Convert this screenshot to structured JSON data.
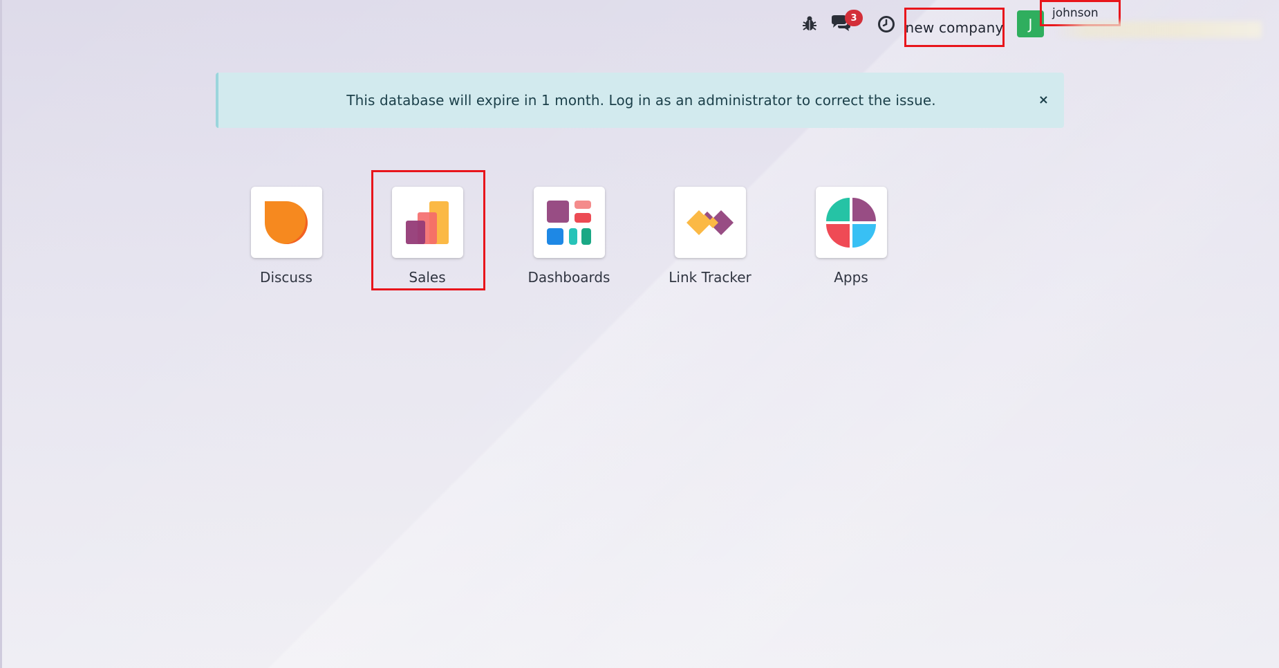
{
  "navbar": {
    "icons": {
      "debug": "bug-icon",
      "messages": "chat-icon",
      "activities": "clock-icon"
    },
    "messages_badge": "3",
    "company": "new company",
    "user": {
      "avatar_initial": "J",
      "name": "johnson"
    }
  },
  "alert": {
    "message": "This database will expire in 1 month. Log in as an administrator to correct the issue.",
    "close": "×"
  },
  "apps": [
    {
      "label": "Discuss",
      "icon": "discuss-icon"
    },
    {
      "label": "Sales",
      "icon": "sales-icon"
    },
    {
      "label": "Dashboards",
      "icon": "dashboards-icon"
    },
    {
      "label": "Link Tracker",
      "icon": "link-tracker-icon"
    },
    {
      "label": "Apps",
      "icon": "apps-icon"
    }
  ],
  "colors": {
    "highlight": "#e8151b",
    "badge": "#d32f39",
    "avatar": "#2fae5e",
    "alert_bg": "#d2eaee"
  }
}
